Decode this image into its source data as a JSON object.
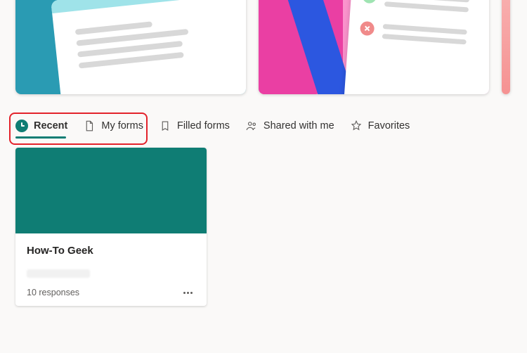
{
  "tabs": {
    "recent": "Recent",
    "myForms": "My forms",
    "filledForms": "Filled forms",
    "sharedWithMe": "Shared with me",
    "favorites": "Favorites"
  },
  "formCard": {
    "title": "How-To Geek",
    "responses": "10 responses"
  },
  "colors": {
    "accent": "#0f7d74",
    "highlight": "#e3222b"
  }
}
